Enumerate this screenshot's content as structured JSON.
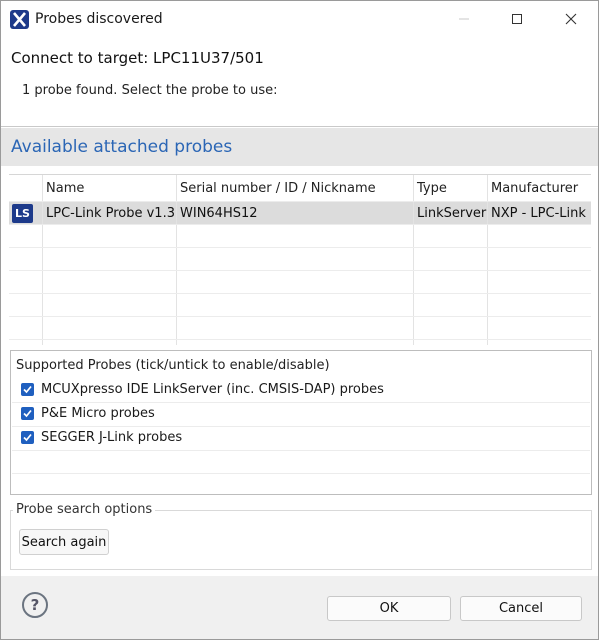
{
  "window": {
    "title": "Probes discovered",
    "icon": "x-app-icon",
    "controls": [
      "minimize",
      "maximize",
      "close"
    ]
  },
  "header": {
    "title": "Connect to target: LPC11U37/501",
    "message": "1 probe found. Select the probe to use:"
  },
  "probes_section": {
    "title": "Available attached probes",
    "columns": [
      "Name",
      "Serial number / ID / Nickname",
      "Type",
      "Manufacturer"
    ],
    "rows": [
      {
        "icon": "LS",
        "name": "LPC-Link Probe v1.3",
        "serial": "WIN64HS12",
        "type": "LinkServer",
        "manufacturer": "NXP - LPC-Link",
        "selected": true
      }
    ]
  },
  "supported_probes": {
    "label": "Supported Probes (tick/untick to enable/disable)",
    "items": [
      {
        "label": "MCUXpresso IDE LinkServer (inc. CMSIS-DAP) probes",
        "checked": true
      },
      {
        "label": "P&E Micro probes",
        "checked": true
      },
      {
        "label": "SEGGER J-Link probes",
        "checked": true
      }
    ]
  },
  "search_options": {
    "label": "Probe search options",
    "search_again": "Search again"
  },
  "buttons": {
    "help": "?",
    "ok": "OK",
    "cancel": "Cancel"
  },
  "colors": {
    "accent": "#2b66b5",
    "checkbox": "#1f5fbf",
    "badge": "#1d3a8a"
  }
}
